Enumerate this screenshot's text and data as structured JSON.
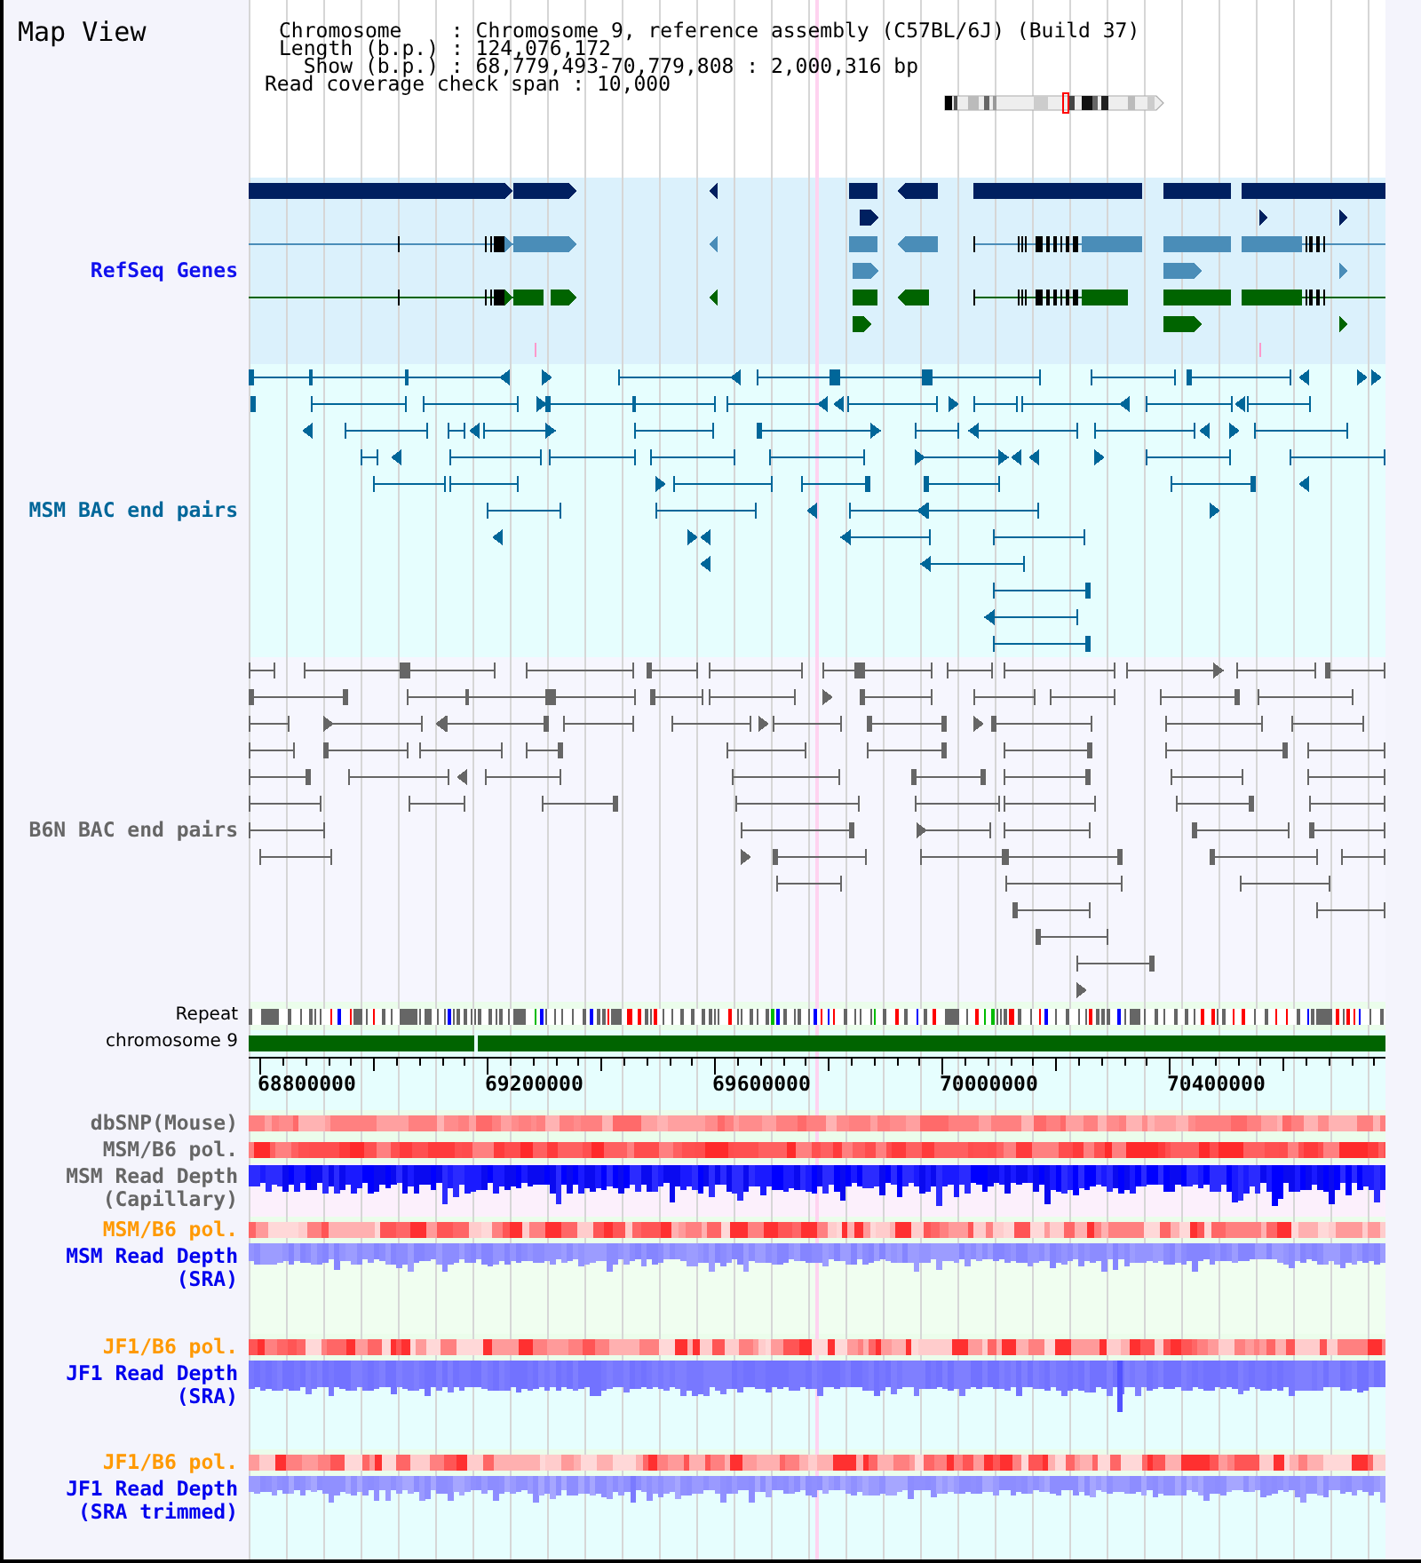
{
  "title": "Map View",
  "info": [
    {
      "label": "Chromosome",
      "sep": ":",
      "value": "Chromosome 9, reference assembly (C57BL/6J) (Build 37)"
    },
    {
      "label": "Length (b.p.)",
      "sep": ":",
      "value": "124,076,172"
    },
    {
      "label": "Show (b.p.)",
      "sep": ":",
      "value": "68,779,493-70,779,808 : 2,000,316 bp"
    },
    {
      "label": "Read coverage check span",
      "sep": ":",
      "value": "10,000"
    }
  ],
  "tracks": [
    {
      "kind": "genes",
      "label": "RefSeq Genes",
      "color": "#1010ee"
    },
    {
      "kind": "pairs",
      "label": "MSM BAC end pairs",
      "color": "#006699"
    },
    {
      "kind": "pairs",
      "label": "B6N BAC end pairs",
      "color": "#666666"
    },
    {
      "kind": "repeat",
      "label": "Repeat",
      "color": "#000000"
    },
    {
      "kind": "chromosome",
      "label": "chromosome 9",
      "color": "#000000"
    },
    {
      "kind": "axis",
      "ticks": [
        "68800000",
        "69200000",
        "69600000",
        "70000000",
        "70400000"
      ]
    },
    {
      "kind": "heatmap",
      "label": "dbSNP(Mouse)",
      "color": "#666666"
    },
    {
      "kind": "heatmap",
      "label": "MSM/B6 pol.",
      "color": "#666666"
    },
    {
      "kind": "capillary",
      "label_lines": [
        "MSM Read Depth",
        "(Capillary)"
      ],
      "color": "#666666"
    },
    {
      "kind": "heatmap",
      "label": "MSM/B6 pol.",
      "color": "#ff9900"
    },
    {
      "kind": "coverage",
      "label_lines": [
        "MSM Read Depth",
        "(SRA)"
      ],
      "color": "#0000ee"
    },
    {
      "kind": "heatmap",
      "label": "JF1/B6 pol.",
      "color": "#ff9900"
    },
    {
      "kind": "coverage",
      "label_lines": [
        "JF1 Read Depth",
        "(SRA)"
      ],
      "color": "#0000ee"
    },
    {
      "kind": "heatmap",
      "label": "JF1/B6 pol.",
      "color": "#ff9900"
    },
    {
      "kind": "coverage",
      "label_lines": [
        "JF1 Read Depth",
        "(SRA trimmed)"
      ],
      "color": "#0000ee"
    }
  ]
}
